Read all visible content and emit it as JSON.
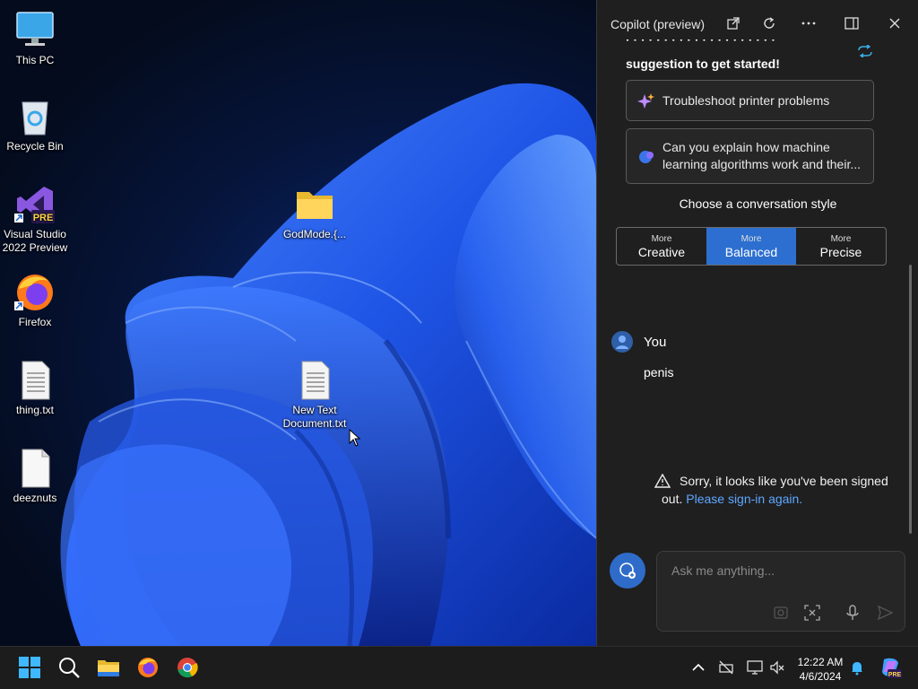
{
  "desktop": {
    "icons": [
      {
        "name": "This PC"
      },
      {
        "name": "Recycle Bin"
      },
      {
        "name": "Visual Studio 2022 Preview",
        "line1": "Visual Studio",
        "line2": "2022 Preview",
        "badge": "PRE"
      },
      {
        "name": "Firefox"
      },
      {
        "name": "thing.txt"
      },
      {
        "name": "deeznuts"
      },
      {
        "name": "GodMode.{..."
      },
      {
        "name": "New Text Document.txt",
        "line1": "New Text",
        "line2": "Document.txt"
      }
    ]
  },
  "copilot": {
    "title": "Copilot (preview)",
    "intro_line2": "suggestion to get started!",
    "suggestions": [
      {
        "text": "Troubleshoot printer problems",
        "icon": "sparkle-icon"
      },
      {
        "text": "Can you explain how machine learning algorithms work and their...",
        "icon": "chat-bubble-icon"
      }
    ],
    "style_title": "Choose a conversation style",
    "styles": [
      {
        "small": "More",
        "label": "Creative",
        "selected": false
      },
      {
        "small": "More",
        "label": "Balanced",
        "selected": true
      },
      {
        "small": "More",
        "label": "Precise",
        "selected": false
      }
    ],
    "user_label": "You",
    "user_message": "penis",
    "warning_text": "Sorry, it looks like you've been signed out.",
    "warning_link": "Please sign-in again.",
    "input_placeholder": "Ask me anything...",
    "accent": "#2c6fd0"
  },
  "taskbar": {
    "time": "12:22 AM",
    "date": "4/6/2024",
    "copilot_badge": "PRE"
  }
}
